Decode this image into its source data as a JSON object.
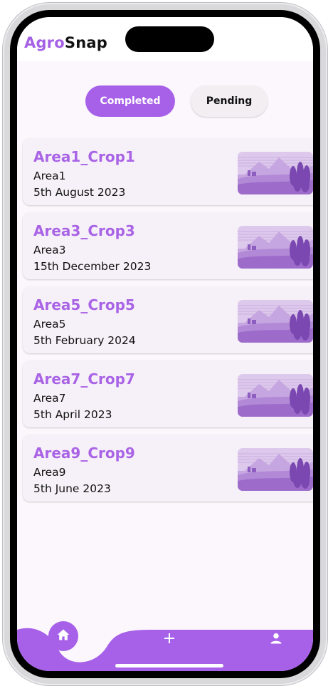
{
  "app": {
    "brand_part1": "Agro",
    "brand_part2": "Snap"
  },
  "tabs": [
    {
      "label": "Completed",
      "active": true
    },
    {
      "label": "Pending",
      "active": false
    }
  ],
  "items": [
    {
      "title": "Area1_Crop1",
      "area": "Area1",
      "date": "5th August 2023"
    },
    {
      "title": "Area3_Crop3",
      "area": "Area3",
      "date": "15th December 2023"
    },
    {
      "title": "Area5_Crop5",
      "area": "Area5",
      "date": "5th February 2024"
    },
    {
      "title": "Area7_Crop7",
      "area": "Area7",
      "date": "5th April 2023"
    },
    {
      "title": "Area9_Crop9",
      "area": "Area9",
      "date": "5th June 2023"
    }
  ],
  "nav": {
    "items": [
      "home-icon",
      "plus-icon",
      "profile-icon"
    ],
    "active": "home-icon"
  },
  "colors": {
    "accent": "#a761e8",
    "title": "#a964e6",
    "background": "#fcf7fc",
    "card": "#f6f1f8"
  }
}
